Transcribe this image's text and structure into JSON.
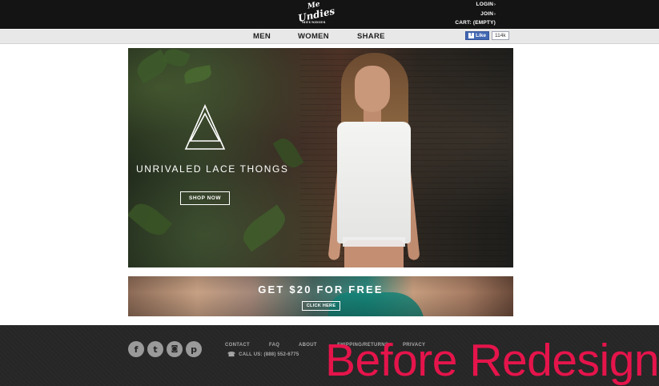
{
  "header": {
    "logo": {
      "line1": "Me",
      "line2": "Undies",
      "line3": "MEUNDIES"
    },
    "account": [
      {
        "label": "LOGIN",
        "arrow": "›"
      },
      {
        "label": "JOIN",
        "arrow": "›"
      },
      {
        "label": "CART: (EMPTY)",
        "arrow": ""
      }
    ]
  },
  "nav": {
    "items": [
      "MEN",
      "WOMEN",
      "SHARE"
    ],
    "fb_like": {
      "label": "Like",
      "icon": "f",
      "count": "114k"
    }
  },
  "hero": {
    "headline": "UNRIVALED LACE THONGS",
    "cta": "SHOP NOW"
  },
  "promo": {
    "title": "GET $20 FOR FREE",
    "cta": "CLICK HERE"
  },
  "footer": {
    "social": [
      {
        "name": "facebook-icon",
        "glyph": "f"
      },
      {
        "name": "twitter-icon",
        "glyph": "t"
      },
      {
        "name": "instagram-icon",
        "glyph": "◙"
      },
      {
        "name": "pinterest-icon",
        "glyph": "p"
      }
    ],
    "links": [
      "CONTACT",
      "FAQ",
      "ABOUT",
      "SHIPPING/RETURNS",
      "PRIVACY"
    ],
    "phone": "CALL US: (888) 552-6775"
  },
  "overlay_text": "Before Redesign",
  "colors": {
    "header": "#141414",
    "nav": "#e8e8e8",
    "footer": "#262626",
    "overlay": "#e5144b",
    "fb": "#4267b2"
  }
}
